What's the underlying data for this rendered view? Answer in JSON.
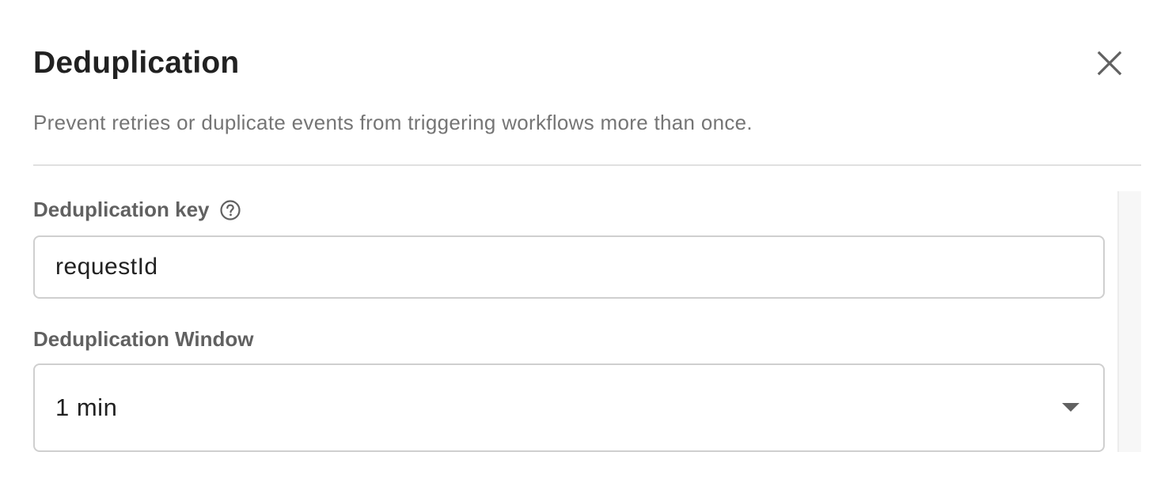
{
  "dialog": {
    "title": "Deduplication",
    "subtitle": "Prevent retries or duplicate events from triggering workflows more than once."
  },
  "icons": {
    "close": "close-icon",
    "help": "help-circle-icon",
    "dropdown": "chevron-down-icon"
  },
  "fields": {
    "key": {
      "label": "Deduplication key",
      "value": "requestId"
    },
    "window": {
      "label": "Deduplication Window",
      "value": "1 min"
    }
  },
  "colors": {
    "text_primary": "#212121",
    "text_secondary": "#757575",
    "label": "#616161",
    "border": "#cfcfcf",
    "divider": "#e0e0e0"
  }
}
